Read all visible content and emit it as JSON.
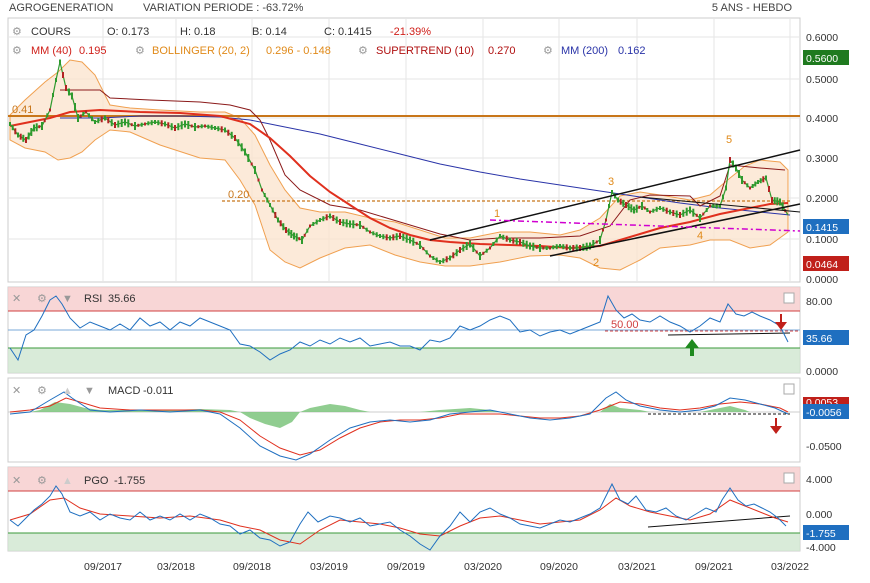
{
  "header": {
    "title": "AGROGENERATION",
    "variation_label": "VARIATION PERIODE : -63.72%",
    "period_label": "5 ANS - HEBDO"
  },
  "legend_main": {
    "cours": "COURS",
    "open": "O: 0.173",
    "high": "H: 0.18",
    "low": "B: 0.14",
    "close": "C: 0.1415",
    "change": "-21.39%",
    "mm40": "MM (40)",
    "mm40_value": "0.195",
    "bollinger": "BOLLINGER (20, 2)",
    "bollinger_value": "0.296 - 0.148",
    "supertrend": "SUPERTREND (10)",
    "supertrend_value": "0.270",
    "mm200": "MM (200)",
    "mm200_value": "0.162"
  },
  "indicators": {
    "rsi_label": "RSI",
    "rsi_value": "35.66",
    "macd_label": "MACD",
    "macd_value": "-0.011",
    "pgo_label": "PGO",
    "pgo_value": "-1.755"
  },
  "annotations": {
    "level_041": "0.41",
    "level_020": "0.20",
    "wave1": "1",
    "wave2": "2",
    "wave3": "3",
    "wave4": "4",
    "wave5": "5",
    "rsi_level": "50.00"
  },
  "badges": {
    "main_high": "0.5600",
    "main_last": "0.1415",
    "main_low": "0.0464",
    "rsi": "35.66",
    "macd_signal": "0.0053",
    "macd": "-0.0056",
    "pgo": "-1.755"
  },
  "x_axis": [
    "09/2017",
    "03/2018",
    "09/2018",
    "03/2019",
    "09/2019",
    "03/2020",
    "09/2020",
    "03/2021",
    "09/2021",
    "03/2022"
  ],
  "main_axis": [
    "0.6000",
    "0.5000",
    "0.4000",
    "0.3000",
    "0.2000",
    "0.1000",
    "0.0000"
  ],
  "rsi_axis": [
    "80.00",
    "0.0000"
  ],
  "macd_axis": [
    "0.0000",
    "-0.0500"
  ],
  "pgo_axis": [
    "4.000",
    "0.000",
    "-4.000"
  ],
  "colors": {
    "candle_up": "#2e9a2e",
    "candle_down": "#b22222",
    "mm40": "#e0301e",
    "mm200": "#2a34a8",
    "bollinger": "#f0a050",
    "supertrend": "#8b1a1a",
    "horizontal_041": "#c8761a",
    "magenta": "#d000d0",
    "rsi_line": "#1f6fc0",
    "macd_line": "#1f6fc0",
    "signal_line": "#e0301e",
    "badge_blue": "#1f6fc0",
    "badge_red": "#c0201a",
    "badge_green": "#1f7a1f"
  },
  "chart_data": {
    "type": "line",
    "title": "AGROGENERATION",
    "x": [
      "2017-04",
      "2017-07",
      "2017-10",
      "2018-01",
      "2018-04",
      "2018-07",
      "2018-10",
      "2019-01",
      "2019-04",
      "2019-07",
      "2019-10",
      "2020-01",
      "2020-04",
      "2020-07",
      "2020-10",
      "2021-01",
      "2021-04",
      "2021-07",
      "2021-10",
      "2022-01",
      "2022-03"
    ],
    "series": [
      {
        "name": "COURS",
        "values": [
          0.36,
          0.53,
          0.42,
          0.38,
          0.39,
          0.36,
          0.2,
          0.11,
          0.14,
          0.1,
          0.05,
          0.08,
          0.1,
          0.08,
          0.09,
          0.2,
          0.18,
          0.17,
          0.29,
          0.22,
          0.1415
        ]
      },
      {
        "name": "MM (40)",
        "values": [
          0.38,
          0.4,
          0.42,
          0.41,
          0.4,
          0.38,
          0.33,
          0.25,
          0.18,
          0.14,
          0.11,
          0.09,
          0.085,
          0.08,
          0.082,
          0.1,
          0.13,
          0.15,
          0.18,
          0.2,
          0.195
        ]
      },
      {
        "name": "MM (200)",
        "values": [
          0.38,
          0.4,
          0.4,
          0.4,
          0.39,
          0.38,
          0.35,
          0.33,
          0.3,
          0.28,
          0.26,
          0.24,
          0.22,
          0.21,
          0.2,
          0.2,
          0.19,
          0.18,
          0.175,
          0.17,
          0.162
        ]
      }
    ],
    "y_range": [
      0,
      0.62
    ],
    "levels": [
      0.41,
      0.2
    ],
    "last_close": 0.1415,
    "rsi": {
      "last": 35.66,
      "level": 50.0,
      "ylim": [
        0,
        100
      ]
    },
    "macd": {
      "last": -0.011
    },
    "pgo": {
      "last": -1.755,
      "ylim": [
        -4,
        4
      ]
    }
  }
}
